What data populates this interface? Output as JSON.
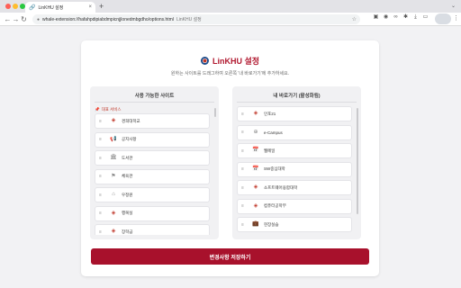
{
  "browser": {
    "tab_title": "LinKHU 설정",
    "url": "whale-extension://hafahpdipiabdmpicnjjlonedmbgdho/options.html",
    "url_tail": "LinKHU 설정"
  },
  "page": {
    "title": "LinKHU 설정",
    "subtitle": "원하는 사이트를 드래그하여 오른쪽 '내 바로가기'에 추가하세요."
  },
  "left_panel": {
    "title": "사용 가능한 사이트",
    "section_label": "대표 서비스",
    "items": [
      {
        "label": "경희대학교",
        "icon": "khu-logo-icon"
      },
      {
        "label": "공지사항",
        "icon": "notice-icon"
      },
      {
        "label": "도서관",
        "icon": "library-icon"
      },
      {
        "label": "체육관",
        "icon": "gym-icon"
      },
      {
        "label": "우정원",
        "icon": "dorm-icon"
      },
      {
        "label": "행복실",
        "icon": "khu-logo-icon"
      },
      {
        "label": "장학금",
        "icon": "khu-logo-icon"
      }
    ]
  },
  "right_panel": {
    "title": "내 바로가기 (활성화됨)",
    "items": [
      {
        "label": "인포21",
        "icon": "khu-logo-icon"
      },
      {
        "label": "e-Campus",
        "icon": "globe-icon"
      },
      {
        "label": "웹메일",
        "icon": "calendar-icon"
      },
      {
        "label": "SW중심대학",
        "icon": "calendar-icon"
      },
      {
        "label": "소프트웨어융합대학",
        "icon": "khu-logo-icon"
      },
      {
        "label": "컴퓨터공학부",
        "icon": "khu-logo-icon"
      },
      {
        "label": "현장실습",
        "icon": "briefcase-icon"
      }
    ]
  },
  "actions": {
    "save_label": "변경사항 저장하기"
  },
  "colors": {
    "accent": "#a8112c",
    "title": "#b0172e",
    "panel_bg": "#f1f1f3"
  }
}
